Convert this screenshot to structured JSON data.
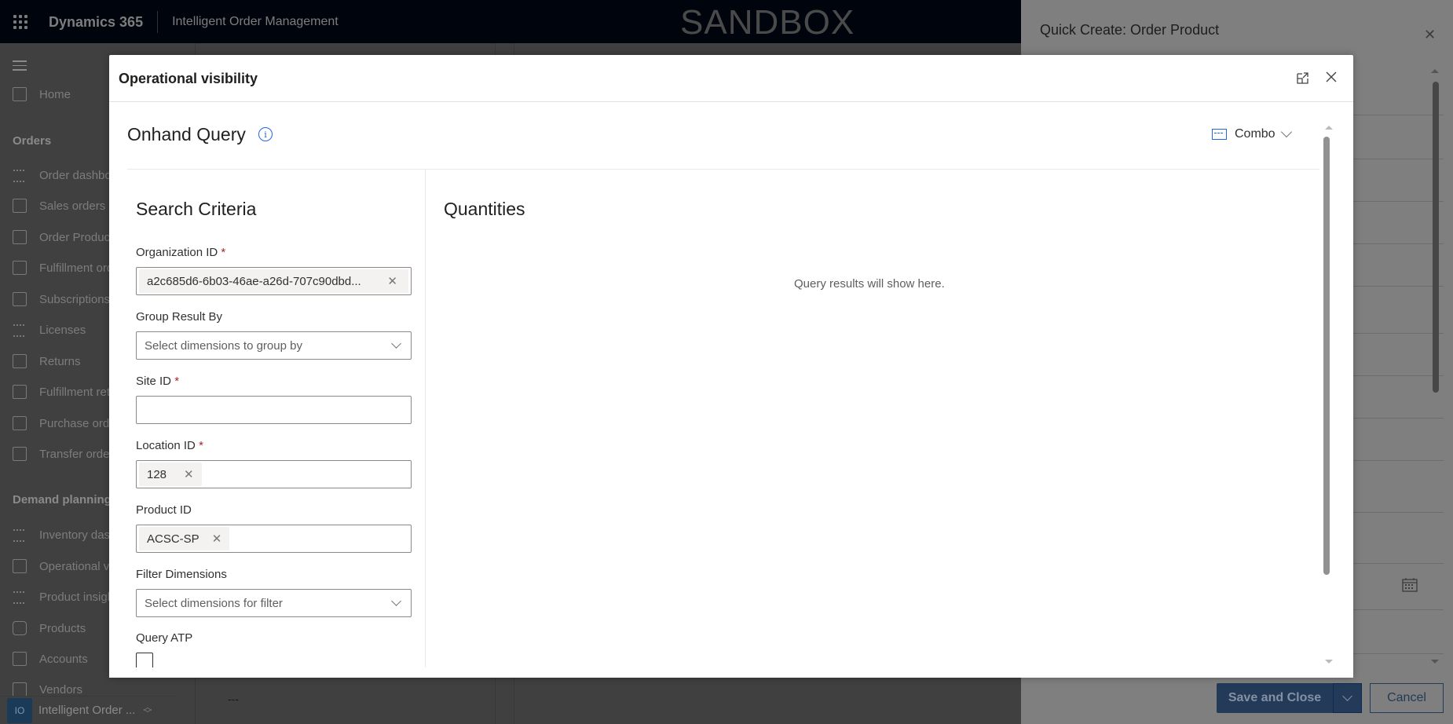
{
  "topbar": {
    "brand": "Dynamics 365",
    "app_name": "Intelligent Order Management",
    "environment_banner": "SANDBOX"
  },
  "sidebar": {
    "home": "Home",
    "groups": [
      {
        "label": "Orders",
        "items": [
          {
            "label": "Order dashboard",
            "icon": "dashboard-icon"
          },
          {
            "label": "Sales orders",
            "icon": "clipboard-icon"
          },
          {
            "label": "Order Products",
            "icon": "document-box-icon"
          },
          {
            "label": "Fulfillment orders",
            "icon": "document-box-icon"
          },
          {
            "label": "Subscriptions",
            "icon": "document-box-icon"
          },
          {
            "label": "Licenses",
            "icon": "dashboard-icon"
          },
          {
            "label": "Returns",
            "icon": "document-box-icon"
          },
          {
            "label": "Fulfillment returns",
            "icon": "document-box-icon"
          },
          {
            "label": "Purchase orders",
            "icon": "document-box-icon"
          },
          {
            "label": "Transfer orders",
            "icon": "document-box-icon"
          }
        ]
      },
      {
        "label": "Demand planning",
        "items": [
          {
            "label": "Inventory dashboard",
            "icon": "dashboard-icon"
          },
          {
            "label": "Operational visibility",
            "icon": "clipboard-icon"
          },
          {
            "label": "Product insights",
            "icon": "dashboard-icon"
          },
          {
            "label": "Products",
            "icon": "box-icon"
          },
          {
            "label": "Accounts",
            "icon": "folder-icon"
          },
          {
            "label": "Vendors",
            "icon": "folder-icon"
          }
        ]
      }
    ],
    "area_badge": "IO",
    "area_label": "Intelligent Order ..."
  },
  "background": {
    "placeholder_dash": "---"
  },
  "quick_create": {
    "title": "Quick Create: Order Product",
    "save_close_label": "Save and Close",
    "cancel_label": "Cancel"
  },
  "modal": {
    "title": "Operational visibility",
    "page_title": "Onhand Query",
    "view_selector": "Combo",
    "search_criteria": {
      "title": "Search Criteria",
      "fields": {
        "organization_id": {
          "label": "Organization ID",
          "required": "*",
          "value": "a2c685d6-6b03-46ae-a26d-707c90dbd..."
        },
        "group_result_by": {
          "label": "Group Result By",
          "placeholder": "Select dimensions to group by"
        },
        "site_id": {
          "label": "Site ID",
          "required": "*",
          "value": ""
        },
        "location_id": {
          "label": "Location ID",
          "required": "*",
          "value": "128"
        },
        "product_id": {
          "label": "Product ID",
          "value": "ACSC-SP"
        },
        "filter_dimensions": {
          "label": "Filter Dimensions",
          "placeholder": "Select dimensions for filter"
        },
        "query_atp": {
          "label": "Query ATP",
          "checked": false
        }
      }
    },
    "quantities": {
      "title": "Quantities",
      "empty_message": "Query results will show here."
    }
  }
}
